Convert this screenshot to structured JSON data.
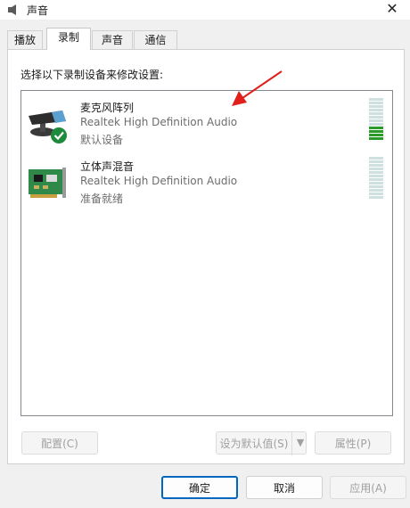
{
  "window": {
    "title": "声音"
  },
  "tabs": [
    {
      "label": "播放"
    },
    {
      "label": "录制"
    },
    {
      "label": "声音"
    },
    {
      "label": "通信"
    }
  ],
  "active_tab_index": 1,
  "instruction": "选择以下录制设备来修改设置:",
  "devices": [
    {
      "name": "麦克风阵列",
      "description": "Realtek High Definition Audio",
      "status": "默认设备",
      "icon": "microphone-icon",
      "is_default": true,
      "level": 0.33
    },
    {
      "name": "立体声混音",
      "description": "Realtek High Definition Audio",
      "status": "准备就绪",
      "icon": "sound-card-icon",
      "is_default": false,
      "level": 0
    }
  ],
  "panel_buttons": {
    "configure": "配置(C)",
    "set_default": "设为默认值(S)",
    "properties": "属性(P)"
  },
  "footer_buttons": {
    "ok": "确定",
    "cancel": "取消",
    "apply": "应用(A)"
  },
  "colors": {
    "accent": "#0067c0",
    "meter_on": "#2a9a2a",
    "arrow": "#e0201c"
  }
}
